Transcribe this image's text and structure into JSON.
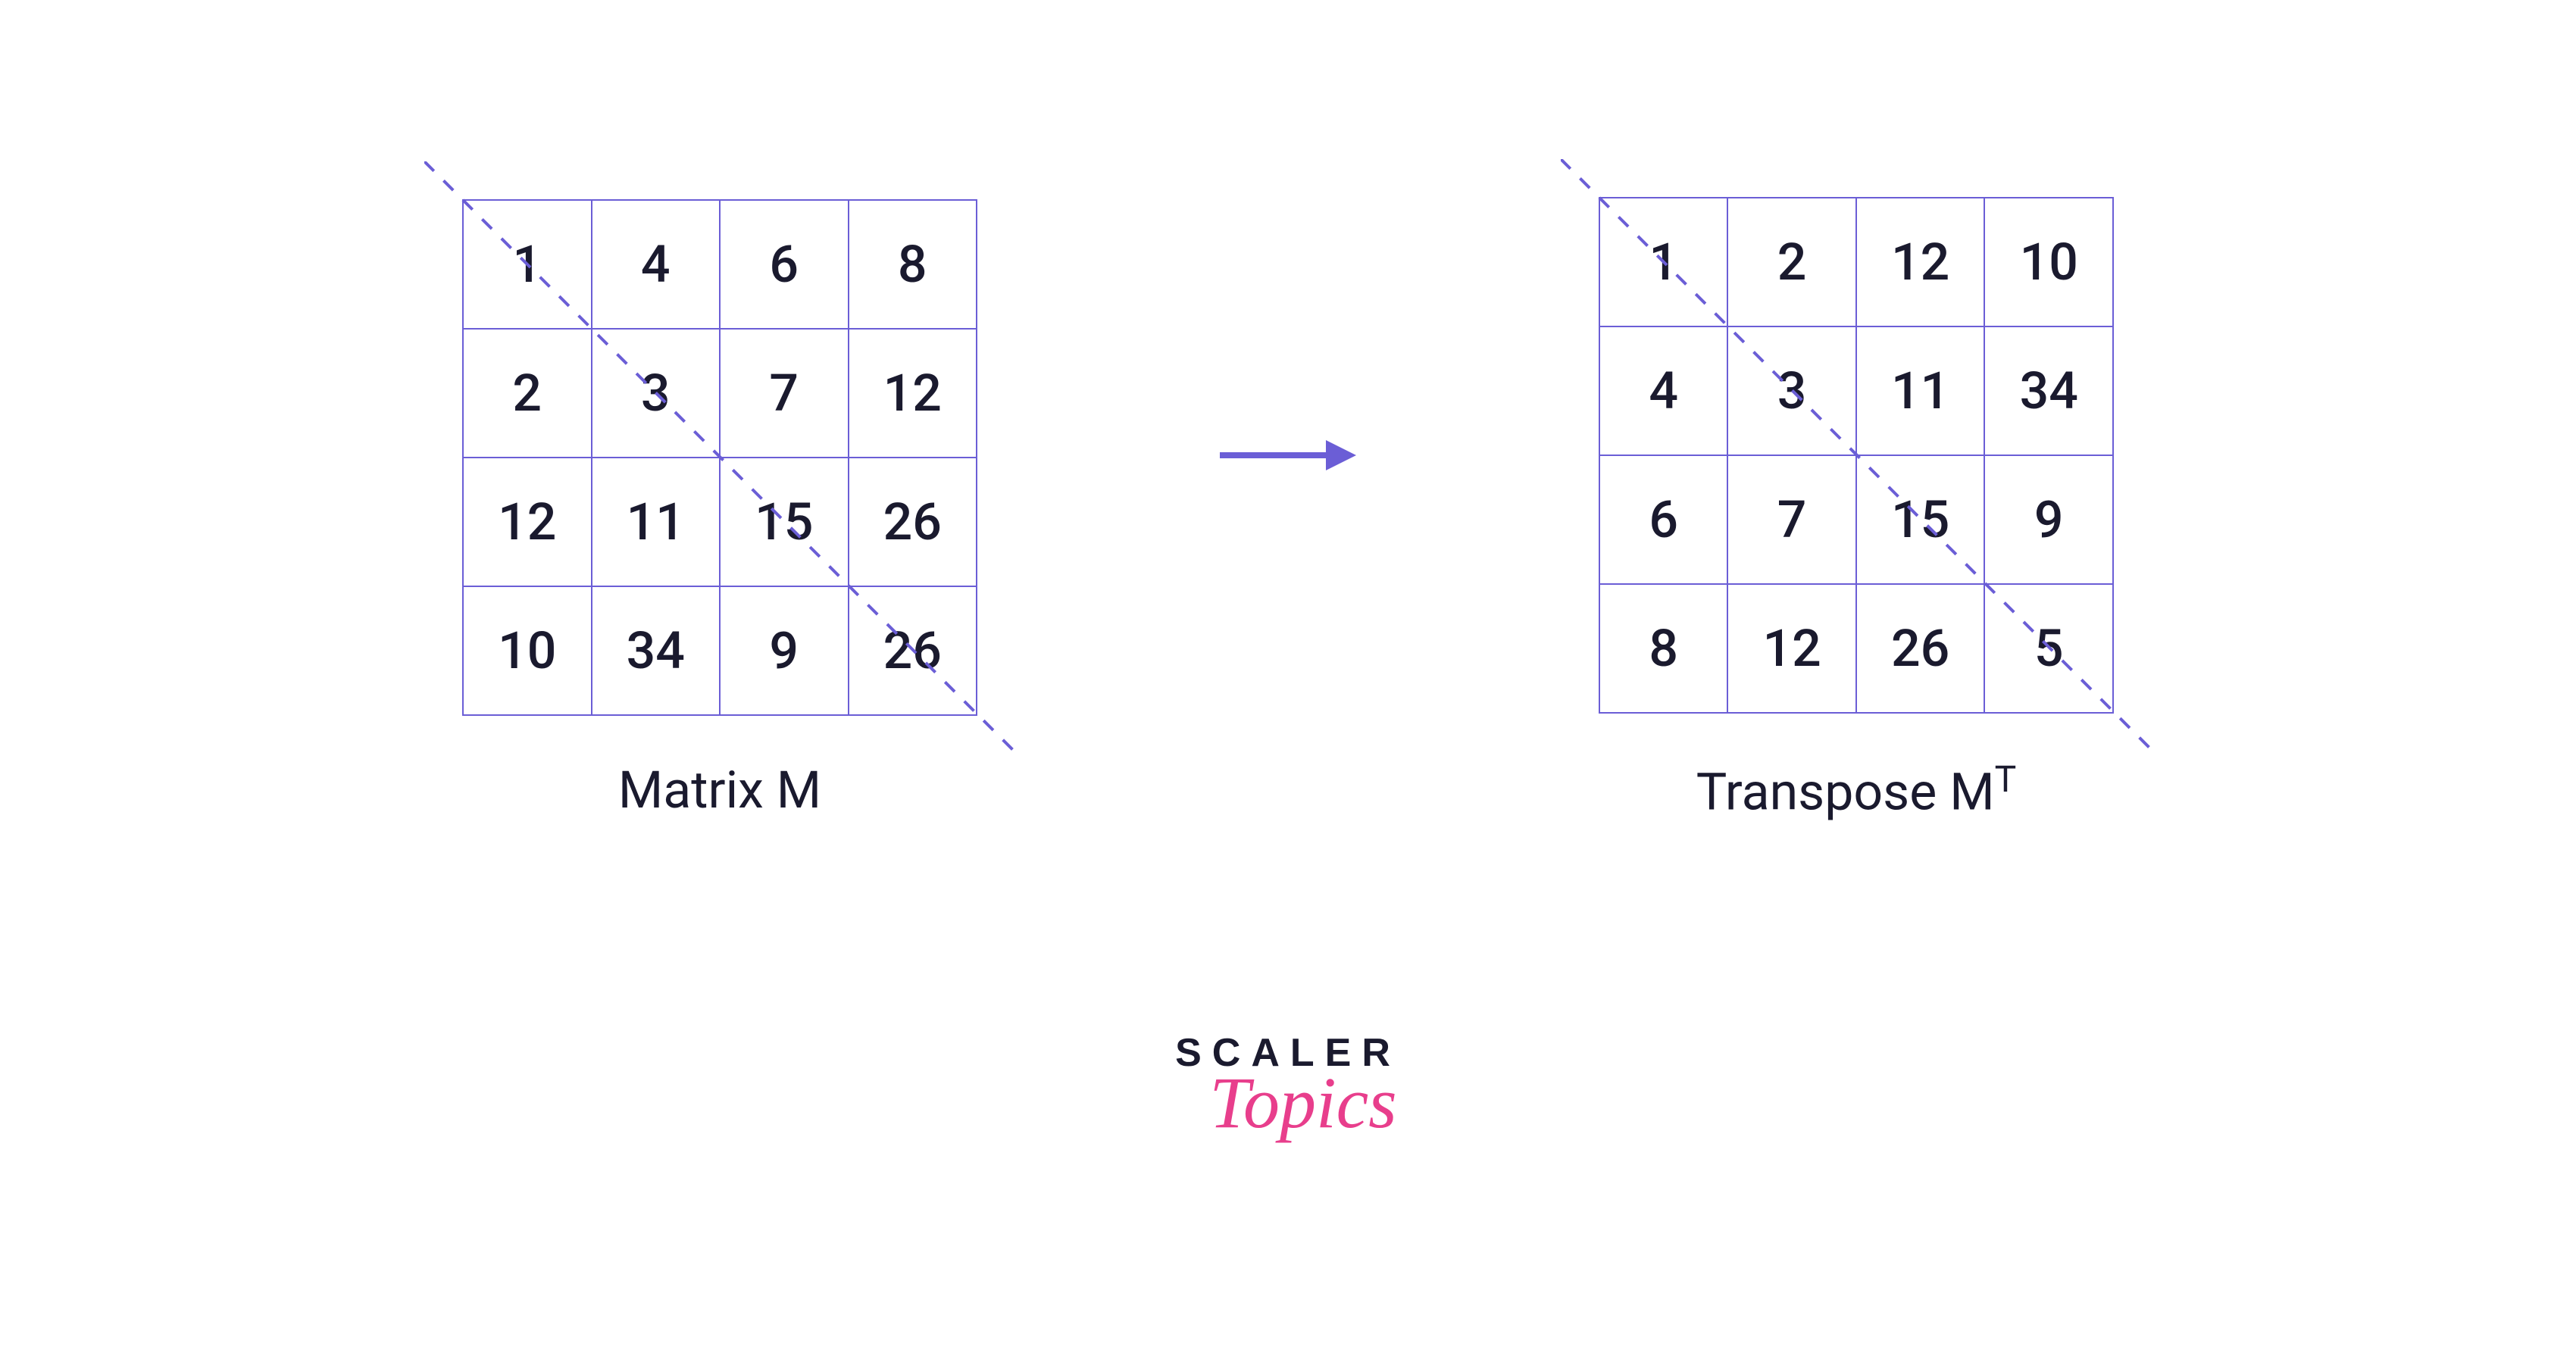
{
  "matrix_m": {
    "label": "Matrix M",
    "data": [
      [
        "1",
        "4",
        "6",
        "8"
      ],
      [
        "2",
        "3",
        "7",
        "12"
      ],
      [
        "12",
        "11",
        "15",
        "26"
      ],
      [
        "10",
        "34",
        "9",
        "26"
      ]
    ]
  },
  "matrix_mt": {
    "label_prefix": "Transpose M",
    "label_super": "T",
    "data": [
      [
        "1",
        "2",
        "12",
        "10"
      ],
      [
        "4",
        "3",
        "11",
        "34"
      ],
      [
        "6",
        "7",
        "15",
        "9"
      ],
      [
        "8",
        "12",
        "26",
        "5"
      ]
    ]
  },
  "logo": {
    "line1": "SCALER",
    "line2": "Topics"
  },
  "colors": {
    "matrix_border": "#6b5ed6",
    "arrow": "#6b5ed6",
    "diagonal": "#6b5ed6",
    "text": "#1a1a2e",
    "accent": "#e83e8c"
  }
}
